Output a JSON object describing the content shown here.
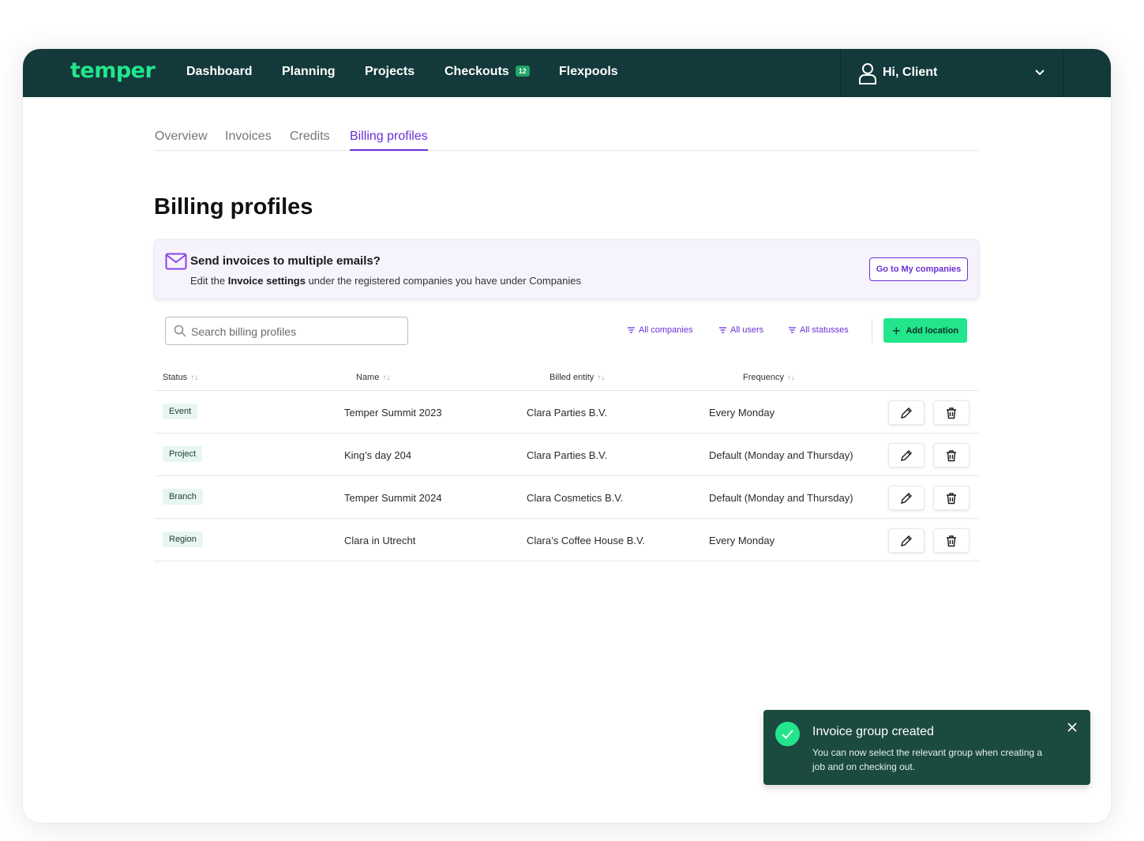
{
  "topbar": {
    "logo": "temper",
    "nav": [
      {
        "label": "Dashboard"
      },
      {
        "label": "Planning"
      },
      {
        "label": "Projects"
      },
      {
        "label": "Checkouts",
        "badge": "12"
      },
      {
        "label": "Flexpools"
      }
    ],
    "user_greeting": "Hi, Client",
    "user_icon": "user-icon",
    "dropdown_icon": "chevron-down-icon"
  },
  "tabs": [
    {
      "label": "Overview",
      "active": false
    },
    {
      "label": "Invoices",
      "active": false
    },
    {
      "label": "Credits",
      "active": false
    },
    {
      "label": "Billing profiles",
      "active": true
    }
  ],
  "page_title": "Billing profiles",
  "banner": {
    "icon": "mail-icon",
    "title": "Send invoices to multiple emails?",
    "text_before": "Edit the ",
    "text_bold": "Invoice settings",
    "text_after": " under the registered companies you have under Companies",
    "button": "Go to My companies"
  },
  "toolbar": {
    "search_placeholder": "Search billing profiles",
    "filters": [
      "All companies",
      "All users",
      "All statusses"
    ],
    "add_button": "Add location"
  },
  "table": {
    "columns": [
      "Status",
      "Name",
      "Billed entity",
      "Frequency"
    ],
    "rows": [
      {
        "status": "Event",
        "name": "Temper Summit 2023",
        "entity": "Clara Parties B.V.",
        "frequency": "Every Monday"
      },
      {
        "status": "Project",
        "name": "King’s day 204",
        "entity": "Clara Parties B.V.",
        "frequency": "Default (Monday and Thursday)"
      },
      {
        "status": "Branch",
        "name": "Temper Summit 2024",
        "entity": "Clara Cosmetics B.V.",
        "frequency": "Default (Monday and Thursday)"
      },
      {
        "status": "Region",
        "name": "Clara in Utrecht",
        "entity": "Clara’s Coffee House B.V.",
        "frequency": "Every Monday"
      }
    ]
  },
  "toast": {
    "title": "Invoice group created",
    "text": "You can now select the relevant group when creating a job and on checking out.",
    "icon": "check-circle-icon"
  },
  "colors": {
    "topbar": "#14393a",
    "brand_green": "#22e58c",
    "accent_purple": "#6b2fd6",
    "toast_bg": "#1b4a41",
    "pill_bg": "#e7f7ef"
  }
}
